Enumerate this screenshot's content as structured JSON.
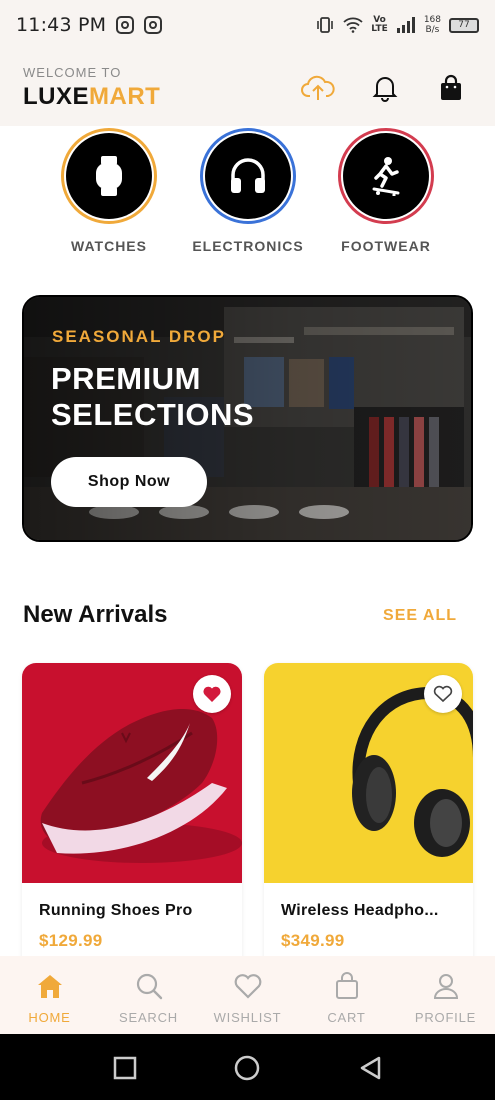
{
  "status_bar": {
    "time": "11:43 PM",
    "volte": "Vo\nLTE",
    "speed": "168\nB/s",
    "battery": "77"
  },
  "header": {
    "welcome": "WELCOME TO",
    "logo_part1": "LUXE",
    "logo_part2": "MART"
  },
  "categories": [
    {
      "label": "WATCHES",
      "icon": "watch-icon",
      "ring_color": "#f0a93a"
    },
    {
      "label": "ELECTRONICS",
      "icon": "headphones-icon",
      "ring_color": "#3a72d8"
    },
    {
      "label": "FOOTWEAR",
      "icon": "skateboarder-icon",
      "ring_color": "#d33c4f"
    }
  ],
  "banner": {
    "eyebrow": "SEASONAL DROP",
    "headline": "PREMIUM SELECTIONS",
    "button": "Shop Now"
  },
  "section": {
    "title": "New Arrivals",
    "see_all": "SEE ALL"
  },
  "products": [
    {
      "name": "Running Shoes Pro",
      "price": "$129.99",
      "favorited": true,
      "image_bg": "#c8102e"
    },
    {
      "name": "Wireless Headpho...",
      "price": "$349.99",
      "favorited": false,
      "image_bg": "#f6d22e"
    }
  ],
  "bottom_nav": [
    {
      "label": "HOME",
      "icon": "home-icon",
      "active": true
    },
    {
      "label": "SEARCH",
      "icon": "search-icon",
      "active": false
    },
    {
      "label": "WISHLIST",
      "icon": "heart-icon",
      "active": false
    },
    {
      "label": "CART",
      "icon": "shopping-bag-icon",
      "active": false
    },
    {
      "label": "PROFILE",
      "icon": "user-icon",
      "active": false
    }
  ],
  "colors": {
    "accent": "#f0a93a",
    "header_bg": "#f8f4f1",
    "nav_bg": "#fdf5f1"
  }
}
